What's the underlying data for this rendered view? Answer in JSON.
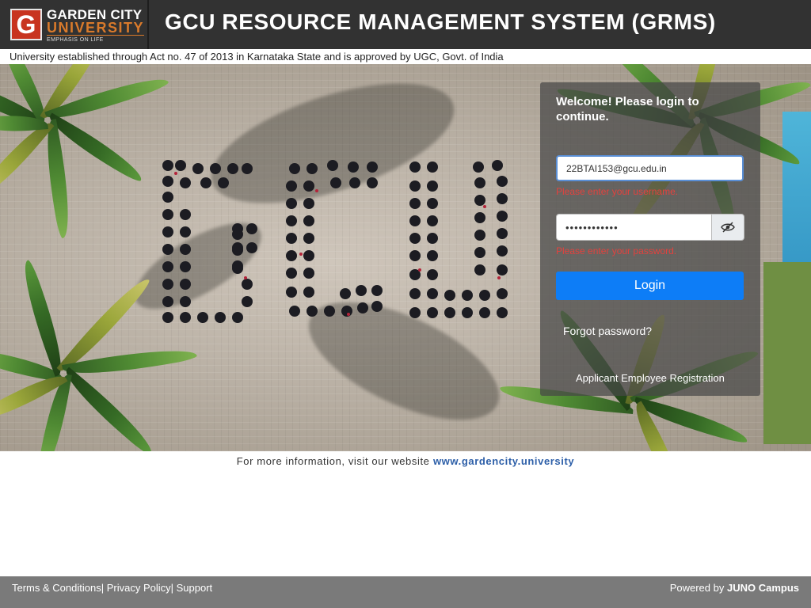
{
  "header": {
    "logo": {
      "letter": "G",
      "line1": "GARDEN CITY",
      "line2": "UNIVERSITY",
      "line3": "EMPHASIS ON LIFE"
    },
    "title": "GCU RESOURCE MANAGEMENT SYSTEM (GRMS)"
  },
  "tagline": "University established through Act no. 47 of 2013 in Karnataka State and is approved by UGC, Govt. of India",
  "login": {
    "welcome": "Welcome! Please login to continue.",
    "username_value": "22BTAI153@gcu.edu.in",
    "username_error": "Please enter your username.",
    "password_value": "••••••••••••",
    "password_error": "Please enter your password.",
    "login_label": "Login",
    "forgot_label": "Forgot password?",
    "register_label": "Applicant Employee Registration"
  },
  "info": {
    "prefix": "For more information, visit our website",
    "link": "www.gardencity.university"
  },
  "footer": {
    "terms": "Terms & Conditions",
    "privacy": "Privacy Policy",
    "support": "Support",
    "powered_prefix": "Powered by",
    "powered_brand": "JUNO Campus"
  },
  "icons": {
    "eye": "eye-slash-icon"
  },
  "colors": {
    "header_bg": "#323232",
    "accent_blue": "#0d7df7",
    "error_red": "#e2423e",
    "footer_bg": "#7a7a7a",
    "link_blue": "#2d5fa8"
  }
}
